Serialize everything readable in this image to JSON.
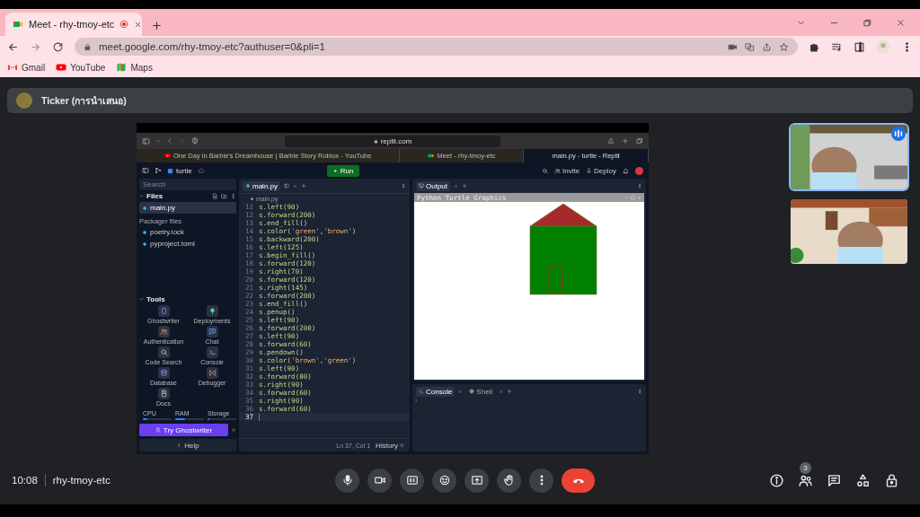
{
  "browser": {
    "tabs": [
      {
        "title": "Meet - rhy-tmoy-etc",
        "selected": true,
        "recording": true
      }
    ],
    "address": "meet.google.com/rhy-tmoy-etc?authuser=0&pli=1",
    "bookmarks": [
      {
        "label": "Gmail",
        "kind": "gmail"
      },
      {
        "label": "YouTube",
        "kind": "youtube"
      },
      {
        "label": "Maps",
        "kind": "maps"
      }
    ]
  },
  "meet": {
    "presentation_title": "Ticker (การนำเสนอ)",
    "shared_screen": {
      "address": "replit.com",
      "tabs": [
        {
          "title": "One Day in Barbie's Dreamhouse | Barbie Story Roblox - YouTube",
          "kind": "youtube",
          "selected": false
        },
        {
          "title": "Meet - rhy-tmoy-etc",
          "kind": "meet",
          "selected": false
        },
        {
          "title": "main.py - turtle - Replit",
          "kind": "replit",
          "selected": true
        }
      ],
      "replit": {
        "project": "turtle",
        "run_label": "Run",
        "invite_label": "Invite",
        "deploy_label": "Deploy",
        "search": {
          "placeholder": "Search"
        },
        "files_title": "Files",
        "files": [
          {
            "name": "main.py",
            "selected": true
          }
        ],
        "packager_title": "Packager files",
        "packager_files": [
          {
            "name": "poetry.lock",
            "selected": false
          },
          {
            "name": "pyproject.toml",
            "selected": false
          }
        ],
        "tools_title": "Tools",
        "tools": [
          {
            "label": "Ghostwriter",
            "kind": "ghostwriter"
          },
          {
            "label": "Deployments",
            "kind": "deployments"
          },
          {
            "label": "Authentication",
            "kind": "authentication"
          },
          {
            "label": "Chat",
            "kind": "chat"
          },
          {
            "label": "Code Search",
            "kind": "search"
          },
          {
            "label": "Console",
            "kind": "console"
          },
          {
            "label": "Database",
            "kind": "database"
          },
          {
            "label": "Debugger",
            "kind": "debugger"
          },
          {
            "label": "Docs",
            "kind": "docs"
          }
        ],
        "resources": [
          {
            "label": "CPU",
            "level": 0.15
          },
          {
            "label": "RAM",
            "level": 0.35
          },
          {
            "label": "Storage",
            "level": 0.05
          }
        ],
        "ghostwriter_button": "Try Ghostwriter",
        "help_button": "Help",
        "editor": {
          "tabs": [
            {
              "label": "main.py",
              "selected": true
            }
          ],
          "breadcrumb": "main.py",
          "lines": [
            {
              "number": "11",
              "text": "s.left(90)",
              "current": false
            },
            {
              "number": "12",
              "text": "s.forward(200)",
              "current": false
            },
            {
              "number": "13",
              "text": "s.end_fill()",
              "current": false
            },
            {
              "number": "14",
              "text": "s.color('green','brown')",
              "current": false
            },
            {
              "number": "15",
              "text": "s.backward(200)",
              "current": false
            },
            {
              "number": "16",
              "text": "s.left(125)",
              "current": false
            },
            {
              "number": "17",
              "text": "s.begin_fill()",
              "current": false
            },
            {
              "number": "18",
              "text": "s.forward(120)",
              "current": false
            },
            {
              "number": "19",
              "text": "s.right(70)",
              "current": false
            },
            {
              "number": "20",
              "text": "s.forward(120)",
              "current": false
            },
            {
              "number": "21",
              "text": "s.right(145)",
              "current": false
            },
            {
              "number": "22",
              "text": "s.forward(200)",
              "current": false
            },
            {
              "number": "23",
              "text": "s.end_fill()",
              "current": false
            },
            {
              "number": "24",
              "text": "s.penup()",
              "current": false
            },
            {
              "number": "25",
              "text": "s.left(90)",
              "current": false
            },
            {
              "number": "26",
              "text": "s.forward(200)",
              "current": false
            },
            {
              "number": "27",
              "text": "s.left(90)",
              "current": false
            },
            {
              "number": "28",
              "text": "s.forward(60)",
              "current": false
            },
            {
              "number": "29",
              "text": "s.pendown()",
              "current": false
            },
            {
              "number": "30",
              "text": "s.color('brown','green')",
              "current": false
            },
            {
              "number": "31",
              "text": "s.left(90)",
              "current": false
            },
            {
              "number": "32",
              "text": "s.forward(80)",
              "current": false
            },
            {
              "number": "33",
              "text": "s.right(90)",
              "current": false
            },
            {
              "number": "34",
              "text": "s.forward(60)",
              "current": false
            },
            {
              "number": "35",
              "text": "s.right(90)",
              "current": false
            },
            {
              "number": "36",
              "text": "s.forward(60)",
              "current": false
            },
            {
              "number": "37",
              "current": true
            }
          ],
          "position": "Ln 37, Col 1",
          "history": "History"
        },
        "output": {
          "tabs": [
            {
              "label": "Output",
              "selected": true
            }
          ],
          "window_title": "Python Turtle Graphics"
        },
        "bottom_tabs": [
          {
            "label": "Console",
            "selected": true
          },
          {
            "label": "Shell",
            "selected": false
          }
        ]
      }
    },
    "tiles": [
      {
        "kind": "picture",
        "speaking": true
      },
      {
        "kind": "picture",
        "speaking": false
      }
    ],
    "clock": "10:08",
    "meeting_code": "rhy-tmoy-etc",
    "participants_badge": "3"
  }
}
